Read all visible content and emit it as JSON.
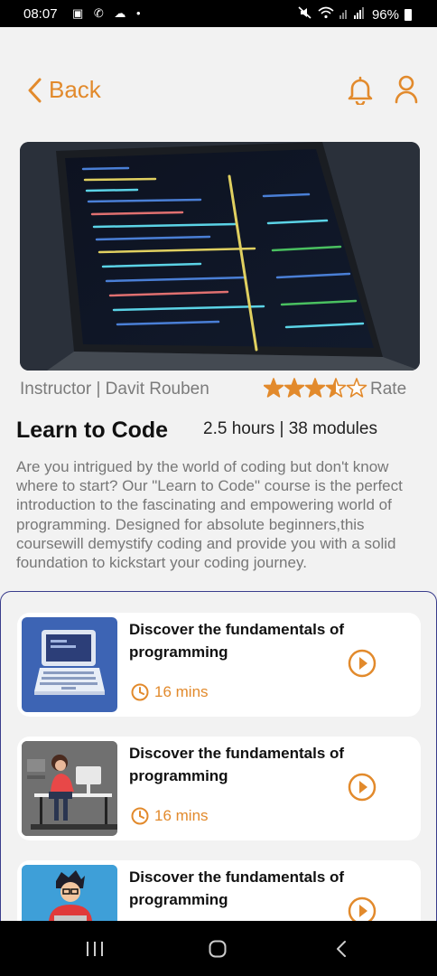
{
  "status_bar": {
    "time": "08:07",
    "left_icons": "▣ ✆ ☁ •",
    "battery": "96%"
  },
  "nav": {
    "back_label": "Back",
    "bell_icon": "bell-icon",
    "user_icon": "user-icon"
  },
  "hero": {
    "icon": "laptop-code-photo"
  },
  "course": {
    "instructor": "Instructor | Davit Rouben",
    "rating": 3.5,
    "rating_max": 5,
    "rate_label": "Rate",
    "title": "Learn to Code",
    "stats": "2.5 hours | 38 modules",
    "description": "Are you intrigued by the world of coding but don't know where to start? Our \"Learn to Code\" course is the perfect introduction to the fascinating and empowering world of programming. Designed for absolute beginners,this coursewill demystify coding and provide you with a solid foundation to kickstart your coding journey."
  },
  "modules": [
    {
      "title": "Discover the fundamentals of programming",
      "duration": "16 mins"
    },
    {
      "title": "Discover the fundamentals of programming",
      "duration": "16 mins"
    },
    {
      "title": "Discover the fundamentals of programming",
      "duration": ""
    }
  ],
  "colors": {
    "accent": "#e28a2c",
    "panel_border": "#3a3d8c",
    "background": "#f2f2f2"
  }
}
